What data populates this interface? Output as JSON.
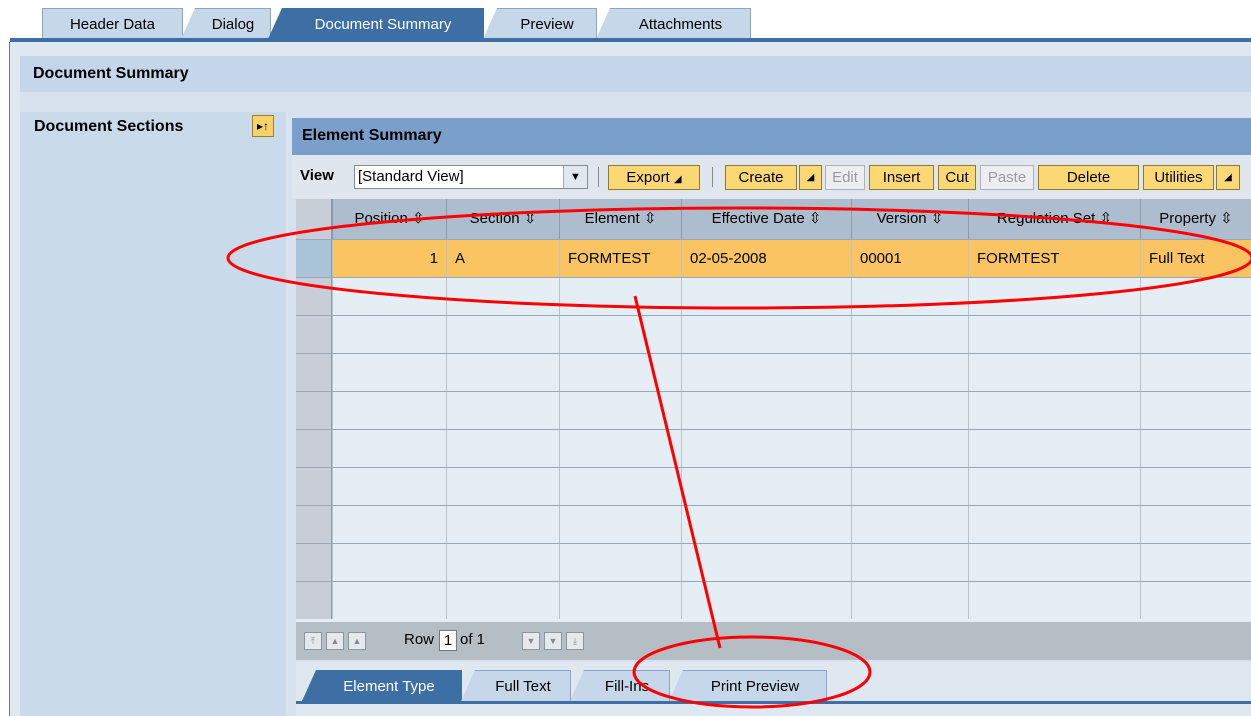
{
  "top_tabs": [
    {
      "label": "Header Data",
      "active": false
    },
    {
      "label": "Dialog",
      "active": false
    },
    {
      "label": "Document Summary",
      "active": true
    },
    {
      "label": "Preview",
      "active": false
    },
    {
      "label": "Attachments",
      "active": false
    }
  ],
  "page": {
    "title": "Document Summary"
  },
  "sidebar": {
    "title": "Document Sections",
    "collapse_icon": "expand-collapse-icon"
  },
  "panel": {
    "title": "Element Summary"
  },
  "toolbar": {
    "view_label": "View",
    "view_value": "[Standard View]",
    "export": "Export",
    "create": "Create",
    "edit": "Edit",
    "insert": "Insert",
    "cut": "Cut",
    "paste": "Paste",
    "delete": "Delete",
    "utilities": "Utilities"
  },
  "table": {
    "columns": [
      "Position",
      "Section",
      "Element",
      "Effective Date",
      "Version",
      "Regulation Set",
      "Property"
    ],
    "rows": [
      {
        "position": "1",
        "section": "A",
        "element": "FORMTEST",
        "effective_date": "02-05-2008",
        "version": "00001",
        "regulation_set": "FORMTEST",
        "property": "Full Text"
      }
    ]
  },
  "pager": {
    "row_label": "Row",
    "current": "1",
    "of_label": "of 1"
  },
  "bottom_tabs": [
    {
      "label": "Element Type",
      "active": true
    },
    {
      "label": "Full Text",
      "active": false
    },
    {
      "label": "Fill-Ins",
      "active": false
    },
    {
      "label": "Print Preview",
      "active": false
    }
  ],
  "colors": {
    "accent": "#3d6fa5",
    "selected_row": "#fbc463",
    "button": "#fbd874",
    "annotation": "#ff0000"
  }
}
